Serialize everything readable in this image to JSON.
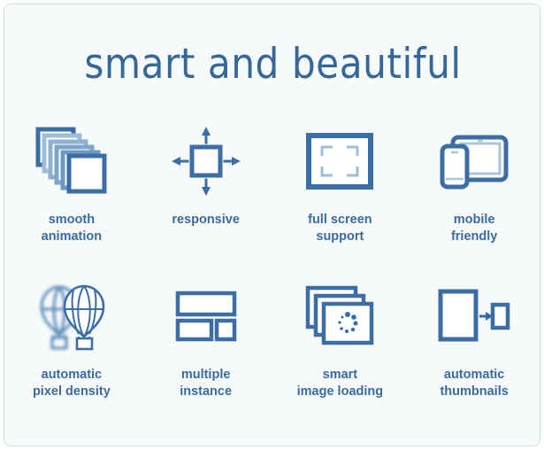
{
  "page": {
    "title": "smart and beautiful",
    "background_color": "#f7fafb",
    "border_color": "#cfe0e4",
    "title_color": "#356899",
    "label_color": "#3a6ba0",
    "icon_stroke_color": "#3a6ea5",
    "icon_stroke_light_color": "#a8c4dc"
  },
  "features": [
    {
      "icon": "stacked-frames-icon",
      "label": "smooth\nanimation",
      "line1": "smooth",
      "line2": "animation"
    },
    {
      "icon": "resize-arrows-icon",
      "label": "responsive",
      "line1": "responsive",
      "line2": ""
    },
    {
      "icon": "fullscreen-frame-icon",
      "label": "full screen\nsupport",
      "line1": "full screen",
      "line2": "support"
    },
    {
      "icon": "phone-tablet-icon",
      "label": "mobile\nfriendly",
      "line1": "mobile",
      "line2": "friendly"
    },
    {
      "icon": "hot-air-balloons-icon",
      "label": "automatic\npixel density",
      "line1": "automatic",
      "line2": "pixel density"
    },
    {
      "icon": "layout-blocks-icon",
      "label": "multiple\ninstance",
      "line1": "multiple",
      "line2": "instance"
    },
    {
      "icon": "loading-images-icon",
      "label": "smart\nimage loading",
      "line1": "smart",
      "line2": "image loading"
    },
    {
      "icon": "resize-thumbnail-icon",
      "label": "automatic\nthumbnails",
      "line1": "automatic",
      "line2": "thumbnails"
    }
  ]
}
